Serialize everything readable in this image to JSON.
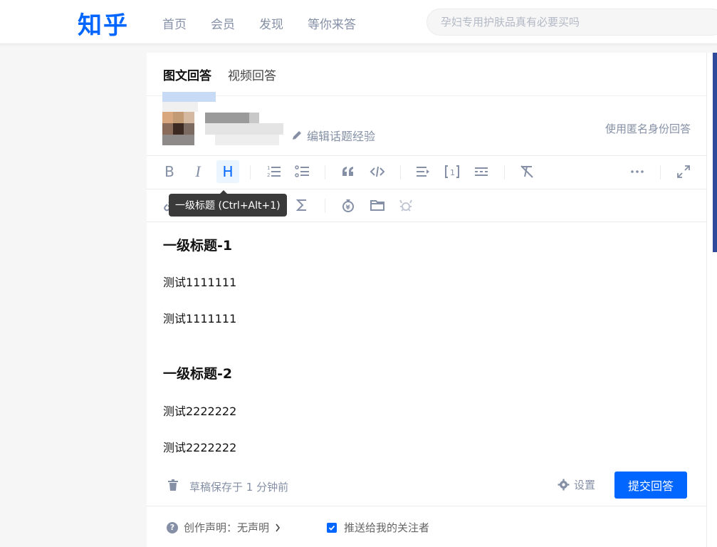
{
  "header": {
    "logo": "知乎",
    "nav": [
      "首页",
      "会员",
      "发现",
      "等你来答"
    ],
    "search_placeholder": "孕妇专用护肤品真有必要买吗"
  },
  "editor": {
    "tabs": [
      "图文回答",
      "视频回答"
    ],
    "edit_topic_label": "编辑话题经验",
    "anonymous_label": "使用匿名身份回答",
    "tooltip": "一级标题 (Ctrl+Alt+1)",
    "toolbar_row1": [
      "bold-icon",
      "italic-icon",
      "heading-icon",
      "ordered-list-icon",
      "bullet-list-icon",
      "quote-icon",
      "code-icon",
      "indent-icon",
      "reference-icon",
      "divider-icon",
      "clear-format-icon",
      "more-icon",
      "fullscreen-icon"
    ],
    "toolbar_row2": [
      "link-icon",
      "table-icon",
      "formula-icon",
      "money-bag-icon",
      "folder-icon",
      "crab-icon"
    ],
    "content": [
      {
        "type": "h1",
        "text": "一级标题-1"
      },
      {
        "type": "p",
        "text": "测试1111111"
      },
      {
        "type": "p",
        "text": "测试1111111"
      },
      {
        "type": "h1",
        "text": "一级标题-2"
      },
      {
        "type": "p",
        "text": "测试2222222"
      },
      {
        "type": "p",
        "text": "测试2222222"
      }
    ]
  },
  "footer": {
    "draft_status": "草稿保存于 1 分钟前",
    "settings_label": "设置",
    "submit_label": "提交回答",
    "declaration_label": "创作声明：无声明",
    "push_label": "推送给我的关注者",
    "push_checked": true
  },
  "colors": {
    "brand": "#0066ff",
    "muted": "#8590a6"
  }
}
